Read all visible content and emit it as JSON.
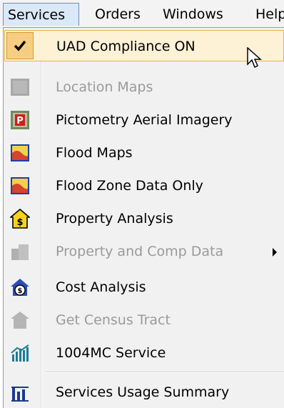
{
  "menubar": {
    "items": [
      {
        "label": "Services",
        "active": true
      },
      {
        "label": "Orders"
      },
      {
        "label": "Windows"
      },
      {
        "label": "Help"
      }
    ]
  },
  "menu": {
    "items": [
      {
        "label": "UAD Compliance ON",
        "checked": true,
        "state": "highlighted",
        "icon": "check-icon"
      },
      {
        "label": "Location Maps",
        "disabled": true,
        "icon": "location-maps-icon"
      },
      {
        "label": "Pictometry Aerial Imagery",
        "icon": "pictometry-icon"
      },
      {
        "label": "Flood Maps",
        "icon": "flood-map-icon"
      },
      {
        "label": "Flood Zone Data Only",
        "icon": "flood-zone-icon"
      },
      {
        "label": "Property Analysis",
        "icon": "property-analysis-icon"
      },
      {
        "label": "Property and Comp Data",
        "disabled": true,
        "submenu": true,
        "icon": "property-comp-icon"
      },
      {
        "label": "Cost Analysis",
        "icon": "cost-analysis-icon"
      },
      {
        "label": "Get Census Tract",
        "disabled": true,
        "icon": "census-tract-icon"
      },
      {
        "label": "1004MC Service",
        "icon": "market-conditions-icon"
      },
      {
        "label": "Services Usage Summary",
        "icon": "usage-summary-icon"
      }
    ]
  },
  "colors": {
    "highlight_bg": "#fdf1d6",
    "highlight_border": "#e2b54d",
    "disabled_text": "#9a9a9a",
    "menu_bg": "#f1f1f1"
  }
}
